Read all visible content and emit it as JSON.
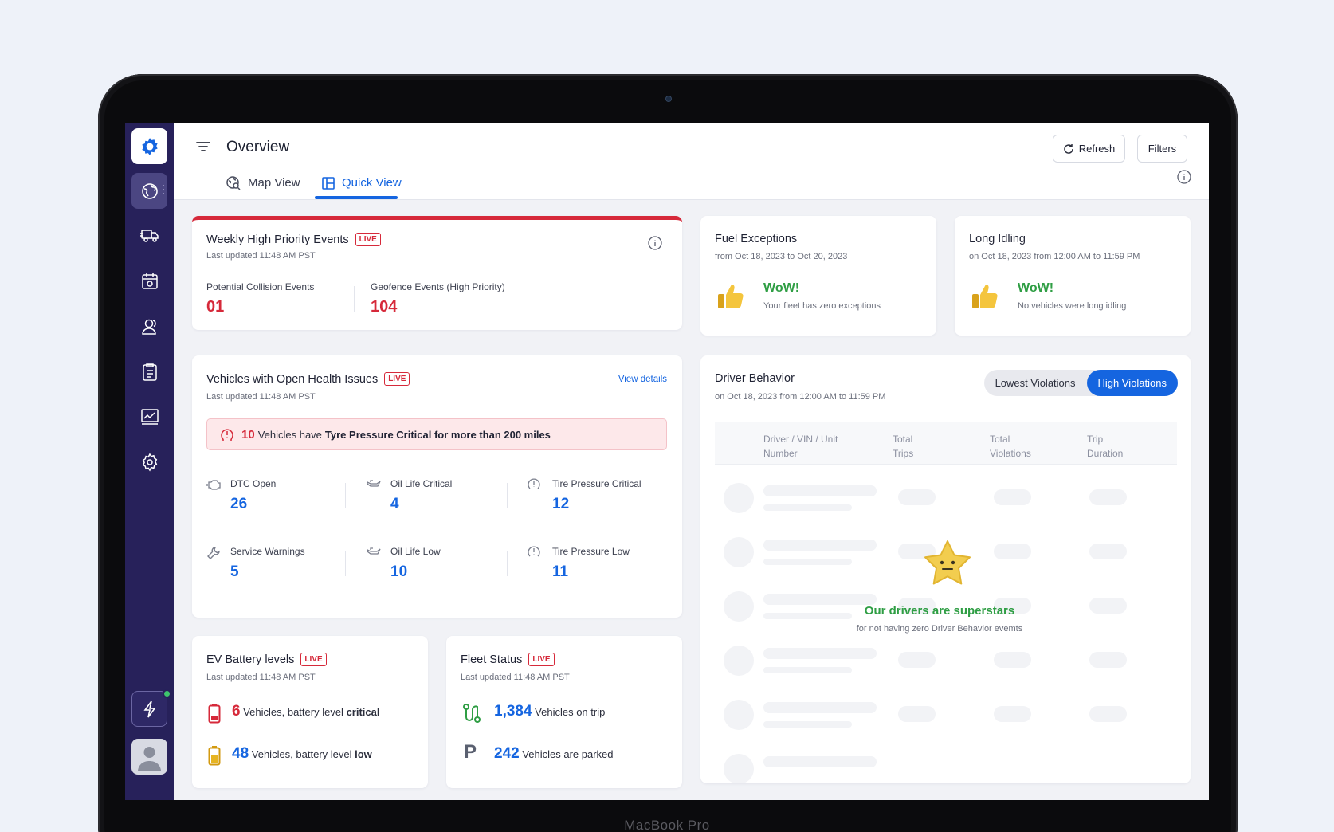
{
  "page": {
    "title": "Overview",
    "refresh_label": "Refresh",
    "filters_label": "Filters"
  },
  "tabs": [
    {
      "label": "Map View",
      "icon": "map-search-icon"
    },
    {
      "label": "Quick View",
      "icon": "grid-layout-icon",
      "active": true
    }
  ],
  "sidebar": {
    "items": [
      "globe-icon",
      "truck-icon",
      "calendar-icon",
      "users-icon",
      "clipboard-icon",
      "analytics-icon",
      "settings-icon"
    ],
    "bottom": [
      "bolt-icon",
      "avatar"
    ]
  },
  "weekly": {
    "title": "Weekly High Priority Events",
    "live": "LIVE",
    "updated": "Last updated 11:48 AM PST",
    "metrics": [
      {
        "label": "Potential Collision Events",
        "value": "01"
      },
      {
        "label": "Geofence Events (High Priority)",
        "value": "104"
      }
    ]
  },
  "fuel": {
    "title": "Fuel Exceptions",
    "sub": "from Oct 18, 2023 to Oct 20, 2023",
    "wow": "WoW!",
    "msg": "Your fleet has zero exceptions"
  },
  "idling": {
    "title": "Long Idling",
    "sub": "on Oct 18, 2023 from 12:00 AM to 11:59 PM",
    "wow": "WoW!",
    "msg": "No vehicles were long idling"
  },
  "health": {
    "title": "Vehicles with Open Health Issues",
    "live": "LIVE",
    "updated": "Last updated 11:48 AM PST",
    "view_details": "View details",
    "alert": {
      "count": "10",
      "pre": "Vehicles have",
      "bold": "Tyre Pressure Critical for more than 200 miles"
    },
    "metrics": [
      {
        "label": "DTC Open",
        "value": "26"
      },
      {
        "label": "Oil Life Critical",
        "value": "4"
      },
      {
        "label": "Tire Pressure Critical",
        "value": "12"
      },
      {
        "label": "Service Warnings",
        "value": "5"
      },
      {
        "label": "Oil Life Low",
        "value": "10"
      },
      {
        "label": "Tire Pressure Low",
        "value": "11"
      }
    ]
  },
  "ev": {
    "title": "EV Battery levels",
    "live": "LIVE",
    "updated": "Last updated 11:48 AM PST",
    "rows": [
      {
        "value": "6",
        "text": "Vehicles, battery level",
        "bold": "critical"
      },
      {
        "value": "48",
        "text": "Vehicles, battery level",
        "bold": "low"
      }
    ]
  },
  "fleet": {
    "title": "Fleet Status",
    "live": "LIVE",
    "updated": "Last updated 11:48 AM PST",
    "rows": [
      {
        "value": "1,384",
        "text": "Vehicles on trip"
      },
      {
        "value": "242",
        "text": "Vehicles are parked"
      }
    ]
  },
  "driver": {
    "title": "Driver Behavior",
    "sub": "on Oct 18, 2023 from 12:00 AM to 11:59 PM",
    "toggle": [
      "Lowest Violations",
      "High Violations"
    ],
    "columns": [
      "Driver / VIN / Unit Number",
      "Total Trips",
      "Total Violations",
      "Trip Duration"
    ],
    "empty_title": "Our drivers are superstars",
    "empty_sub": "for not having zero Driver Behavior evemts"
  },
  "device": {
    "brand": "MacBook Pro"
  },
  "colors": {
    "sidebar": "#27215a",
    "accent": "#1565e0",
    "critical": "#d6293a",
    "success": "#2f9e44"
  }
}
